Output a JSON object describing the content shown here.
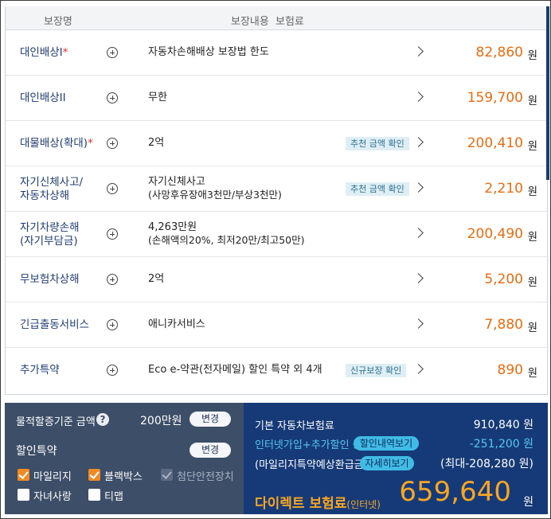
{
  "table": {
    "headers": {
      "coverage": "보장명",
      "detail": "보장내용",
      "premium": "보험료"
    },
    "rows": [
      {
        "name": "대인배상I",
        "required": "*",
        "content": "자동차손해배상 보장법 한도",
        "content_sub": "",
        "tag": "",
        "amount": "82,860",
        "unit": "원"
      },
      {
        "name": "대인배상II",
        "required": "",
        "content": "무한",
        "content_sub": "",
        "tag": "",
        "amount": "159,700",
        "unit": "원"
      },
      {
        "name": "대물배상(확대)",
        "required": "*",
        "content": "2억",
        "content_sub": "",
        "tag": "추천 금액 확인",
        "amount": "200,410",
        "unit": "원"
      },
      {
        "name": "자기신체사고/",
        "name2": "자동차상해",
        "required": "",
        "content": "자기신체사고",
        "content_sub": "(사망후유장애3천만/부상3천만)",
        "tag": "추천 금액 확인",
        "amount": "2,210",
        "unit": "원"
      },
      {
        "name": "자기차량손해",
        "name2": "(자기부담금)",
        "required": "",
        "content": "4,263만원",
        "content_sub": "(손해액의20%, 최저20만/최고50만)",
        "tag": "",
        "amount": "200,490",
        "unit": "원"
      },
      {
        "name": "무보험차상해",
        "required": "",
        "content": "2억",
        "content_sub": "",
        "tag": "",
        "amount": "5,200",
        "unit": "원"
      },
      {
        "name": "긴급출동서비스",
        "required": "",
        "content": "애니카서비스",
        "content_sub": "",
        "tag": "",
        "amount": "7,880",
        "unit": "원"
      },
      {
        "name": "추가특약",
        "required": "",
        "content": "Eco e-약관(전자메일) 할인 특약 외 4개",
        "content_sub": "",
        "tag": "신규보장 확인",
        "amount": "890",
        "unit": "원"
      }
    ]
  },
  "settings": {
    "threshold_label": "물적할증기준 금액",
    "help_icon": "?",
    "threshold_value": "200만원",
    "change_label": "변경",
    "discount_label": "할인특약",
    "discount_change_label": "변경",
    "checkboxes": [
      {
        "label": "마일리지",
        "state": "checked"
      },
      {
        "label": "블랙박스",
        "state": "checked"
      },
      {
        "label": "첨단안전장치",
        "state": "disabled"
      },
      {
        "label": "자녀사랑",
        "state": "unchecked"
      },
      {
        "label": "티맵",
        "state": "unchecked"
      }
    ]
  },
  "summary": {
    "base_label": "기본 자동차보험료",
    "base_value": "910,840 원",
    "discount_label": "인터넷가입+추가할인 등",
    "discount_button": "할인내역보기",
    "discount_value": "-251,200 원",
    "mileage_label": "(마일리지특약예상환급금)",
    "mileage_button": "자세히보기",
    "mileage_value": "(최대-208,280 원)",
    "total_label": "다이렉트 보험료",
    "total_sub": "(인터넷)",
    "total_value": "659,640",
    "total_unit": "원"
  },
  "colors": {
    "amount": "#ef6b0f",
    "name": "#1e3d7b",
    "summary_bg": "#163a78",
    "settings_bg": "#3d4e68",
    "cyan": "#3fbbe6",
    "total": "#f6a623"
  }
}
